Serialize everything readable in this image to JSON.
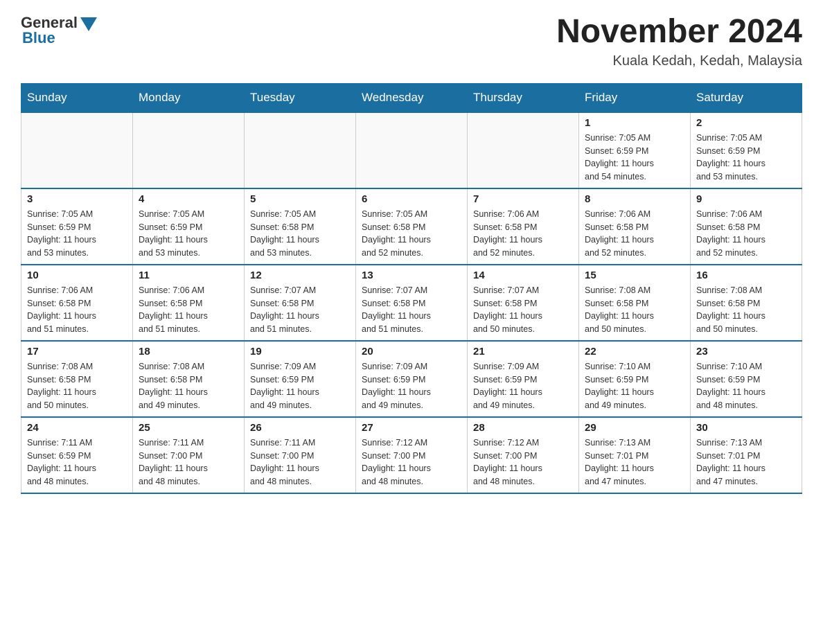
{
  "header": {
    "logo_general": "General",
    "logo_blue": "Blue",
    "month_title": "November 2024",
    "location": "Kuala Kedah, Kedah, Malaysia"
  },
  "days_of_week": [
    "Sunday",
    "Monday",
    "Tuesday",
    "Wednesday",
    "Thursday",
    "Friday",
    "Saturday"
  ],
  "weeks": [
    {
      "days": [
        {
          "number": "",
          "info": ""
        },
        {
          "number": "",
          "info": ""
        },
        {
          "number": "",
          "info": ""
        },
        {
          "number": "",
          "info": ""
        },
        {
          "number": "",
          "info": ""
        },
        {
          "number": "1",
          "info": "Sunrise: 7:05 AM\nSunset: 6:59 PM\nDaylight: 11 hours\nand 54 minutes."
        },
        {
          "number": "2",
          "info": "Sunrise: 7:05 AM\nSunset: 6:59 PM\nDaylight: 11 hours\nand 53 minutes."
        }
      ]
    },
    {
      "days": [
        {
          "number": "3",
          "info": "Sunrise: 7:05 AM\nSunset: 6:59 PM\nDaylight: 11 hours\nand 53 minutes."
        },
        {
          "number": "4",
          "info": "Sunrise: 7:05 AM\nSunset: 6:59 PM\nDaylight: 11 hours\nand 53 minutes."
        },
        {
          "number": "5",
          "info": "Sunrise: 7:05 AM\nSunset: 6:58 PM\nDaylight: 11 hours\nand 53 minutes."
        },
        {
          "number": "6",
          "info": "Sunrise: 7:05 AM\nSunset: 6:58 PM\nDaylight: 11 hours\nand 52 minutes."
        },
        {
          "number": "7",
          "info": "Sunrise: 7:06 AM\nSunset: 6:58 PM\nDaylight: 11 hours\nand 52 minutes."
        },
        {
          "number": "8",
          "info": "Sunrise: 7:06 AM\nSunset: 6:58 PM\nDaylight: 11 hours\nand 52 minutes."
        },
        {
          "number": "9",
          "info": "Sunrise: 7:06 AM\nSunset: 6:58 PM\nDaylight: 11 hours\nand 52 minutes."
        }
      ]
    },
    {
      "days": [
        {
          "number": "10",
          "info": "Sunrise: 7:06 AM\nSunset: 6:58 PM\nDaylight: 11 hours\nand 51 minutes."
        },
        {
          "number": "11",
          "info": "Sunrise: 7:06 AM\nSunset: 6:58 PM\nDaylight: 11 hours\nand 51 minutes."
        },
        {
          "number": "12",
          "info": "Sunrise: 7:07 AM\nSunset: 6:58 PM\nDaylight: 11 hours\nand 51 minutes."
        },
        {
          "number": "13",
          "info": "Sunrise: 7:07 AM\nSunset: 6:58 PM\nDaylight: 11 hours\nand 51 minutes."
        },
        {
          "number": "14",
          "info": "Sunrise: 7:07 AM\nSunset: 6:58 PM\nDaylight: 11 hours\nand 50 minutes."
        },
        {
          "number": "15",
          "info": "Sunrise: 7:08 AM\nSunset: 6:58 PM\nDaylight: 11 hours\nand 50 minutes."
        },
        {
          "number": "16",
          "info": "Sunrise: 7:08 AM\nSunset: 6:58 PM\nDaylight: 11 hours\nand 50 minutes."
        }
      ]
    },
    {
      "days": [
        {
          "number": "17",
          "info": "Sunrise: 7:08 AM\nSunset: 6:58 PM\nDaylight: 11 hours\nand 50 minutes."
        },
        {
          "number": "18",
          "info": "Sunrise: 7:08 AM\nSunset: 6:58 PM\nDaylight: 11 hours\nand 49 minutes."
        },
        {
          "number": "19",
          "info": "Sunrise: 7:09 AM\nSunset: 6:59 PM\nDaylight: 11 hours\nand 49 minutes."
        },
        {
          "number": "20",
          "info": "Sunrise: 7:09 AM\nSunset: 6:59 PM\nDaylight: 11 hours\nand 49 minutes."
        },
        {
          "number": "21",
          "info": "Sunrise: 7:09 AM\nSunset: 6:59 PM\nDaylight: 11 hours\nand 49 minutes."
        },
        {
          "number": "22",
          "info": "Sunrise: 7:10 AM\nSunset: 6:59 PM\nDaylight: 11 hours\nand 49 minutes."
        },
        {
          "number": "23",
          "info": "Sunrise: 7:10 AM\nSunset: 6:59 PM\nDaylight: 11 hours\nand 48 minutes."
        }
      ]
    },
    {
      "days": [
        {
          "number": "24",
          "info": "Sunrise: 7:11 AM\nSunset: 6:59 PM\nDaylight: 11 hours\nand 48 minutes."
        },
        {
          "number": "25",
          "info": "Sunrise: 7:11 AM\nSunset: 7:00 PM\nDaylight: 11 hours\nand 48 minutes."
        },
        {
          "number": "26",
          "info": "Sunrise: 7:11 AM\nSunset: 7:00 PM\nDaylight: 11 hours\nand 48 minutes."
        },
        {
          "number": "27",
          "info": "Sunrise: 7:12 AM\nSunset: 7:00 PM\nDaylight: 11 hours\nand 48 minutes."
        },
        {
          "number": "28",
          "info": "Sunrise: 7:12 AM\nSunset: 7:00 PM\nDaylight: 11 hours\nand 48 minutes."
        },
        {
          "number": "29",
          "info": "Sunrise: 7:13 AM\nSunset: 7:01 PM\nDaylight: 11 hours\nand 47 minutes."
        },
        {
          "number": "30",
          "info": "Sunrise: 7:13 AM\nSunset: 7:01 PM\nDaylight: 11 hours\nand 47 minutes."
        }
      ]
    }
  ]
}
